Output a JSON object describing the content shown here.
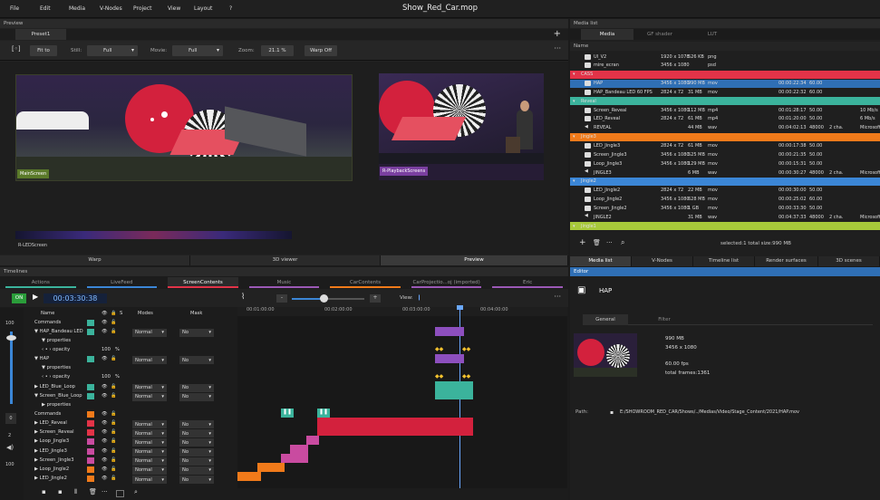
{
  "menu": {
    "items": [
      "File",
      "Edit",
      "Media",
      "V-Nodes",
      "Project",
      "View",
      "Layout",
      "?"
    ]
  },
  "window_title": "Show_Red_Car.mop",
  "preview": {
    "title": "Preview",
    "preset_tab": "Preset1",
    "fit_label": "Fit to",
    "still_label": "Still:",
    "still_value": "Full",
    "movie_label": "Movie:",
    "movie_value": "Full",
    "zoom_label": "Zoom:",
    "zoom_value": "21.1 %",
    "warp_label": "Warp Off",
    "screens": [
      "MainScreen",
      "R-PlaybackScreens",
      "R-LEDScreen"
    ],
    "view_tabs": [
      "Warp",
      "3D viewer",
      "Preview"
    ]
  },
  "media": {
    "title": "Media list",
    "tabs": [
      "Media",
      "GF shader",
      "LUT"
    ],
    "col_name": "Name",
    "rows": [
      {
        "name": "UI_V2",
        "res": "1920 x 1078",
        "size": "526 KB",
        "fmt": "png",
        "dur": "",
        "fps": "",
        "ch": "",
        "extra": "",
        "kind": "file",
        "group": false,
        "selected": false
      },
      {
        "name": "mire_ecran",
        "res": "3456 x 1080",
        "size": "",
        "fmt": "psd",
        "dur": "",
        "fps": "",
        "ch": "",
        "extra": "",
        "kind": "file",
        "group": false,
        "selected": false
      },
      {
        "name": "CASS",
        "res": "",
        "size": "",
        "fmt": "",
        "dur": "",
        "fps": "",
        "ch": "",
        "extra": "",
        "kind": "group",
        "color": "#e23348",
        "group": true,
        "selected": false
      },
      {
        "name": "HAP",
        "res": "3456 x 1080",
        "size": "990 MB",
        "fmt": "mov",
        "dur": "00:00:22:34",
        "fps": "60.00",
        "ch": "",
        "extra": "",
        "kind": "file",
        "group": false,
        "selected": true
      },
      {
        "name": "HAP_Bandeau LED 60 FPS",
        "res": "2824 x 72",
        "size": "31 MB",
        "fmt": "mov",
        "dur": "00:00:22:32",
        "fps": "60.00",
        "ch": "",
        "extra": "",
        "kind": "file",
        "group": false,
        "selected": false
      },
      {
        "name": "Reveal",
        "res": "",
        "size": "",
        "fmt": "",
        "dur": "",
        "fps": "",
        "ch": "",
        "extra": "",
        "kind": "group",
        "color": "#3bb39c",
        "group": true,
        "selected": false
      },
      {
        "name": "Screen_Reveal",
        "res": "3456 x 1080",
        "size": "112 MB",
        "fmt": "mp4",
        "dur": "00:01:28:17",
        "fps": "50.00",
        "ch": "",
        "extra": "10 Mb/s",
        "kind": "file",
        "group": false,
        "selected": false
      },
      {
        "name": "LED_Reveal",
        "res": "2824 x 72",
        "size": "61 MB",
        "fmt": "mp4",
        "dur": "00:01:20:00",
        "fps": "50.00",
        "ch": "",
        "extra": "6 Mb/s",
        "kind": "file",
        "group": false,
        "selected": false
      },
      {
        "name": "REVEAL",
        "res": "",
        "size": "44 MB",
        "fmt": "wav",
        "dur": "00:04:02:13",
        "fps": "48000",
        "ch": "2 cha.",
        "extra": "Microsoft",
        "kind": "audio",
        "group": false,
        "selected": false
      },
      {
        "name": "Jingle3",
        "res": "",
        "size": "",
        "fmt": "",
        "dur": "",
        "fps": "",
        "ch": "",
        "extra": "",
        "kind": "group",
        "color": "#f07a1a",
        "group": true,
        "selected": false
      },
      {
        "name": "LED_Jingle3",
        "res": "2824 x 72",
        "size": "61 MB",
        "fmt": "mov",
        "dur": "00:00:17:38",
        "fps": "50.00",
        "ch": "",
        "extra": "",
        "kind": "file",
        "group": false,
        "selected": false
      },
      {
        "name": "Screen_Jingle3",
        "res": "3456 x 1080",
        "size": "525 MB",
        "fmt": "mov",
        "dur": "00:00:21:35",
        "fps": "50.00",
        "ch": "",
        "extra": "",
        "kind": "file",
        "group": false,
        "selected": false
      },
      {
        "name": "Loop_Jingle3",
        "res": "3456 x 1080",
        "size": "129 MB",
        "fmt": "mov",
        "dur": "00:00:15:31",
        "fps": "50.00",
        "ch": "",
        "extra": "",
        "kind": "file",
        "group": false,
        "selected": false
      },
      {
        "name": "JINGLE3",
        "res": "",
        "size": "6 MB",
        "fmt": "wav",
        "dur": "00:00:30:27",
        "fps": "48000",
        "ch": "2 cha.",
        "extra": "Microsoft",
        "kind": "audio",
        "group": false,
        "selected": false
      },
      {
        "name": "Jingle2",
        "res": "",
        "size": "",
        "fmt": "",
        "dur": "",
        "fps": "",
        "ch": "",
        "extra": "",
        "kind": "group",
        "color": "#3b86d6",
        "group": true,
        "selected": false
      },
      {
        "name": "LED_Jingle2",
        "res": "2824 x 72",
        "size": "22 MB",
        "fmt": "mov",
        "dur": "00:00:30:00",
        "fps": "50.00",
        "ch": "",
        "extra": "",
        "kind": "file",
        "group": false,
        "selected": false
      },
      {
        "name": "Loop_Jingle2",
        "res": "3456 x 1080",
        "size": "628 MB",
        "fmt": "mov",
        "dur": "00:00:25:02",
        "fps": "60.00",
        "ch": "",
        "extra": "",
        "kind": "file",
        "group": false,
        "selected": false
      },
      {
        "name": "Screen_Jingle2",
        "res": "3456 x 1080",
        "size": "1 GB",
        "fmt": "mov",
        "dur": "00:00:33:30",
        "fps": "50.00",
        "ch": "",
        "extra": "",
        "kind": "file",
        "group": false,
        "selected": false
      },
      {
        "name": "JINGLE2",
        "res": "",
        "size": "31 MB",
        "fmt": "wav",
        "dur": "00:04:37:33",
        "fps": "48000",
        "ch": "2 cha.",
        "extra": "Microsoft",
        "kind": "audio",
        "group": false,
        "selected": false
      },
      {
        "name": "Jingle1",
        "res": "",
        "size": "",
        "fmt": "",
        "dur": "",
        "fps": "",
        "ch": "",
        "extra": "",
        "kind": "group",
        "color": "#a7c93a",
        "group": true,
        "selected": false
      }
    ],
    "footer": "selected:1 total size:990 MB",
    "bottom_tabs": [
      "Media list",
      "V-Nodes",
      "Timeline list",
      "Render surfaces",
      "3D scenes"
    ]
  },
  "timeline": {
    "title": "Timelines",
    "tabs": [
      {
        "label": "Actions",
        "color": "#3bb39c"
      },
      {
        "label": "LiveFeed",
        "color": "#3b86d6"
      },
      {
        "label": "ScreenContents",
        "color": "#e23348"
      },
      {
        "label": "Music",
        "color": "#9b59b6"
      },
      {
        "label": "CarContents",
        "color": "#f07a1a"
      },
      {
        "label": "CarProjectio...oj (imported)",
        "color": "#9b59b6"
      },
      {
        "label": "Eric",
        "color": "#9b59b6"
      }
    ],
    "on_label": "ON",
    "timecode": "00:03:30:38",
    "view_label": "View:",
    "ruler": [
      "00:01:00:00",
      "00:02:00:00",
      "00:03:00:00",
      "00:04:00:00"
    ],
    "cols": {
      "name": "Name",
      "s": "S",
      "modes": "Modes",
      "mask": "Mask"
    },
    "volume_top": "100",
    "volume_bottom": "100",
    "side_numbers": [
      "0",
      "2"
    ],
    "rows": [
      {
        "name": "Commands",
        "swatch": "#3bb39c",
        "mode": "",
        "mask": "",
        "indent": 0
      },
      {
        "name": "▼ HAP_Bandeau LED",
        "swatch": "#3bb39c",
        "mode": "Normal",
        "mask": "No",
        "indent": 0
      },
      {
        "name": "▼ properties",
        "swatch": "",
        "mode": "",
        "mask": "",
        "indent": 1
      },
      {
        "name": "‹ • ›  opacity",
        "swatch": "",
        "mode": "",
        "mask": "",
        "indent": 1,
        "value": "100",
        "unit": "%"
      },
      {
        "name": "▼ HAP",
        "swatch": "#3bb39c",
        "mode": "Normal",
        "mask": "No",
        "indent": 0
      },
      {
        "name": "▼ properties",
        "swatch": "",
        "mode": "",
        "mask": "",
        "indent": 1
      },
      {
        "name": "‹ • ›  opacity",
        "swatch": "",
        "mode": "",
        "mask": "",
        "indent": 1,
        "value": "100",
        "unit": "%"
      },
      {
        "name": "▶ LED_Blue_Loop",
        "swatch": "#3bb39c",
        "mode": "Normal",
        "mask": "No",
        "indent": 0
      },
      {
        "name": "▼ Screen_Blue_Loop",
        "swatch": "#3bb39c",
        "mode": "Normal",
        "mask": "No",
        "indent": 0
      },
      {
        "name": "▶ properties",
        "swatch": "",
        "mode": "",
        "mask": "",
        "indent": 1
      },
      {
        "name": "Commands",
        "swatch": "#f07a1a",
        "mode": "",
        "mask": "",
        "indent": 0
      },
      {
        "name": "▶ LED_Reveal",
        "swatch": "#e23348",
        "mode": "Normal",
        "mask": "No",
        "indent": 0
      },
      {
        "name": "▶ Screen_Reveal",
        "swatch": "#e23348",
        "mode": "Normal",
        "mask": "No",
        "indent": 0
      },
      {
        "name": "▶ Loop_Jingle3",
        "swatch": "#c94ba0",
        "mode": "Normal",
        "mask": "No",
        "indent": 0
      },
      {
        "name": "▶ LED_Jingle3",
        "swatch": "#c94ba0",
        "mode": "Normal",
        "mask": "No",
        "indent": 0
      },
      {
        "name": "▶ Screen_Jingle3",
        "swatch": "#c94ba0",
        "mode": "Normal",
        "mask": "No",
        "indent": 0
      },
      {
        "name": "▶ Loop_Jingle2",
        "swatch": "#f07a1a",
        "mode": "Normal",
        "mask": "No",
        "indent": 0
      },
      {
        "name": "▶ LED_Jingle2",
        "swatch": "#f07a1a",
        "mode": "Normal",
        "mask": "No",
        "indent": 0
      }
    ]
  },
  "editor": {
    "title": "Editor",
    "name": "HAP",
    "tabs": [
      "General",
      "Filter"
    ],
    "size": "990 MB",
    "res": "3456 x 1080",
    "fps": "60.00 fps",
    "frames": "total frames:1361",
    "path_label": "Path:",
    "path": "E:/SHOWROOM_RED_CAR/Shows/../Medias/Video/Stage_Content/2021/HAP.mov"
  }
}
